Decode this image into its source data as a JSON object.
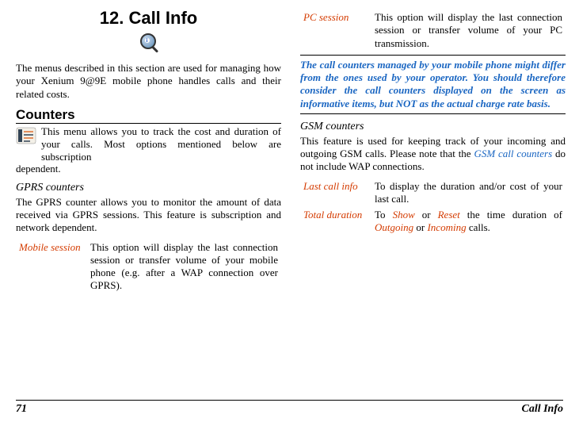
{
  "chapter": {
    "title": "12. Call Info"
  },
  "col1": {
    "intro": "The menus described in this section are used for managing how your Xenium 9@9E mobile phone handles calls and their related costs.",
    "section_counters": "Counters",
    "counters_intro_part1": "This menu allows you to track the cost and duration of your calls. Most options mentioned below are subscription",
    "counters_intro_part2": "dependent.",
    "sub_gprs": "GPRS counters",
    "gprs_para": "The GPRS counter allows you to monitor the amount of data received via GPRS sessions. This feature is subscription and network dependent.",
    "rows": {
      "mobile": {
        "label": "Mobile session",
        "text": "This option will display the last connection session or transfer volume of your mobile phone (e.g. after a WAP connection over GPRS)."
      }
    }
  },
  "col2": {
    "rows": {
      "pc": {
        "label": "PC session",
        "text": "This option will display the last connection session or transfer volume of your PC transmission."
      }
    },
    "callout": "The call counters managed by your mobile phone might differ from the ones used by your operator. You should therefore consider the call counters displayed on the screen as informative items, but NOT as the actual charge rate basis.",
    "sub_gsm": "GSM counters",
    "gsm_para_pre": "This feature is used for keeping track of your incoming and outgoing GSM calls. Please note that the ",
    "gsm_link": "GSM call counters",
    "gsm_para_post": " do not include WAP connections.",
    "rows2": {
      "lastcall": {
        "label": "Last call info",
        "text": "To display the duration and/or cost of your last call."
      },
      "total": {
        "label": "Total duration",
        "pre": "To ",
        "show": "Show",
        "mid1": " or ",
        "reset": "Reset",
        "mid2": " the time duration of ",
        "outgoing": "Outgoing",
        "mid3": " or ",
        "incoming": "Incoming",
        "post": " calls."
      }
    }
  },
  "footer": {
    "page": "71",
    "title": "Call Info"
  }
}
